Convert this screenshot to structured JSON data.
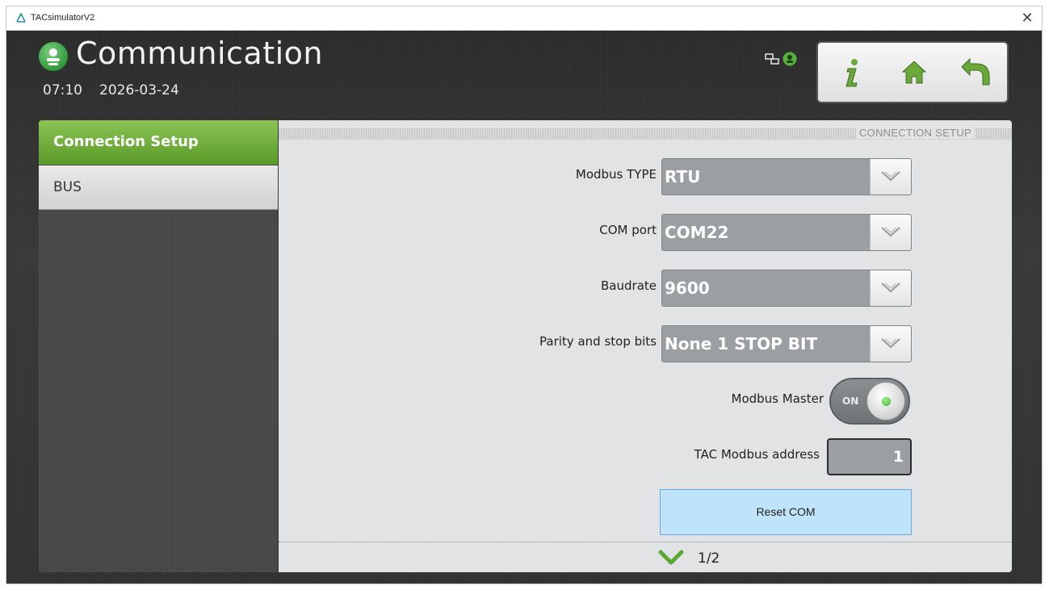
{
  "window": {
    "title": "TACsimulatorV2",
    "close_glyph": "✕"
  },
  "header": {
    "title": "Communication",
    "time": "07:10",
    "date": "2026-03-24",
    "icon": "user-group-icon"
  },
  "nav_buttons": [
    "info-icon",
    "home-icon",
    "back-icon"
  ],
  "sidebar": {
    "items": [
      {
        "label": "Connection Setup",
        "active": true
      },
      {
        "label": "BUS",
        "active": false
      }
    ]
  },
  "panel": {
    "section_title": "CONNECTION SETUP",
    "modbus_type": {
      "label": "Modbus TYPE",
      "value": "RTU"
    },
    "com_port": {
      "label": "COM port",
      "value": "COM22"
    },
    "baudrate": {
      "label": "Baudrate",
      "value": "9600"
    },
    "parity": {
      "label": "Parity and stop bits",
      "value": "None 1 STOP BIT"
    },
    "modbus_master": {
      "label": "Modbus Master",
      "state": "ON"
    },
    "tac_address": {
      "label": "TAC Modbus address",
      "value": "1"
    },
    "reset_button": "Reset COM",
    "pager": "1/2"
  },
  "colors": {
    "accent_green": "#6aaa3a",
    "panel_bg": "#e1e3e4",
    "dropdown_bg": "#9a9fa2",
    "button_blue": "#bfe3f8"
  }
}
